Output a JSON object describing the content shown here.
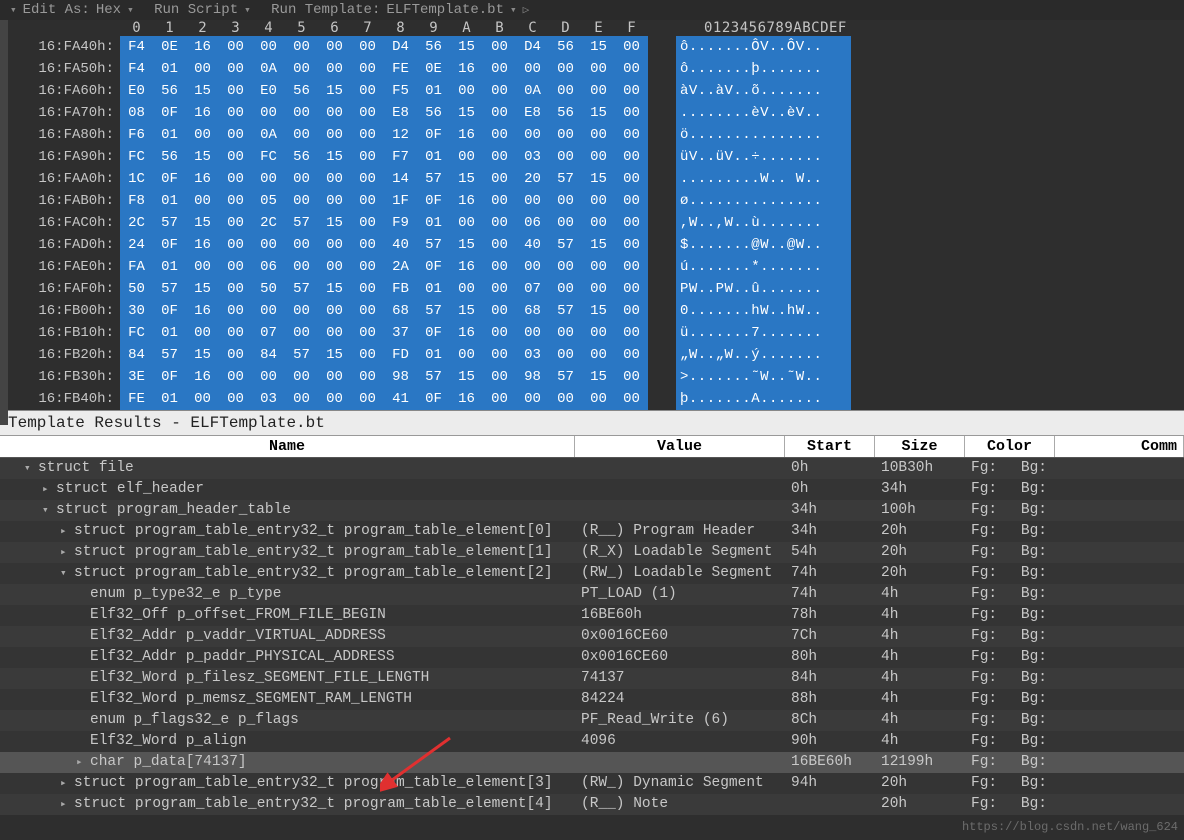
{
  "toolbar": {
    "editAs": "Edit As:",
    "editMode": "Hex",
    "runScript": "Run Script",
    "runTemplate": "Run Template:",
    "templateName": "ELFTemplate.bt"
  },
  "hexHeader": {
    "cols": [
      "0",
      "1",
      "2",
      "3",
      "4",
      "5",
      "6",
      "7",
      "8",
      "9",
      "A",
      "B",
      "C",
      "D",
      "E",
      "F"
    ],
    "ascii": "0123456789ABCDEF"
  },
  "rows": [
    {
      "addr": "16:FA40h:",
      "bytes": [
        "F4",
        "0E",
        "16",
        "00",
        "00",
        "00",
        "00",
        "00",
        "D4",
        "56",
        "15",
        "00",
        "D4",
        "56",
        "15",
        "00"
      ],
      "ascii": "ô.......ÔV..ÔV.."
    },
    {
      "addr": "16:FA50h:",
      "bytes": [
        "F4",
        "01",
        "00",
        "00",
        "0A",
        "00",
        "00",
        "00",
        "FE",
        "0E",
        "16",
        "00",
        "00",
        "00",
        "00",
        "00"
      ],
      "ascii": "ô.......þ......."
    },
    {
      "addr": "16:FA60h:",
      "bytes": [
        "E0",
        "56",
        "15",
        "00",
        "E0",
        "56",
        "15",
        "00",
        "F5",
        "01",
        "00",
        "00",
        "0A",
        "00",
        "00",
        "00"
      ],
      "ascii": "àV..àV..õ......."
    },
    {
      "addr": "16:FA70h:",
      "bytes": [
        "08",
        "0F",
        "16",
        "00",
        "00",
        "00",
        "00",
        "00",
        "E8",
        "56",
        "15",
        "00",
        "E8",
        "56",
        "15",
        "00"
      ],
      "ascii": "........èV..èV.."
    },
    {
      "addr": "16:FA80h:",
      "bytes": [
        "F6",
        "01",
        "00",
        "00",
        "0A",
        "00",
        "00",
        "00",
        "12",
        "0F",
        "16",
        "00",
        "00",
        "00",
        "00",
        "00"
      ],
      "ascii": "ö..............."
    },
    {
      "addr": "16:FA90h:",
      "bytes": [
        "FC",
        "56",
        "15",
        "00",
        "FC",
        "56",
        "15",
        "00",
        "F7",
        "01",
        "00",
        "00",
        "03",
        "00",
        "00",
        "00"
      ],
      "ascii": "üV..üV..÷......."
    },
    {
      "addr": "16:FAA0h:",
      "bytes": [
        "1C",
        "0F",
        "16",
        "00",
        "00",
        "00",
        "00",
        "00",
        "14",
        "57",
        "15",
        "00",
        "20",
        "57",
        "15",
        "00"
      ],
      "ascii": ".........W.. W.."
    },
    {
      "addr": "16:FAB0h:",
      "bytes": [
        "F8",
        "01",
        "00",
        "00",
        "05",
        "00",
        "00",
        "00",
        "1F",
        "0F",
        "16",
        "00",
        "00",
        "00",
        "00",
        "00"
      ],
      "ascii": "ø..............."
    },
    {
      "addr": "16:FAC0h:",
      "bytes": [
        "2C",
        "57",
        "15",
        "00",
        "2C",
        "57",
        "15",
        "00",
        "F9",
        "01",
        "00",
        "00",
        "06",
        "00",
        "00",
        "00"
      ],
      "ascii": ",W..,W..ù......."
    },
    {
      "addr": "16:FAD0h:",
      "bytes": [
        "24",
        "0F",
        "16",
        "00",
        "00",
        "00",
        "00",
        "00",
        "40",
        "57",
        "15",
        "00",
        "40",
        "57",
        "15",
        "00"
      ],
      "ascii": "$.......@W..@W.."
    },
    {
      "addr": "16:FAE0h:",
      "bytes": [
        "FA",
        "01",
        "00",
        "00",
        "06",
        "00",
        "00",
        "00",
        "2A",
        "0F",
        "16",
        "00",
        "00",
        "00",
        "00",
        "00"
      ],
      "ascii": "ú.......*......."
    },
    {
      "addr": "16:FAF0h:",
      "bytes": [
        "50",
        "57",
        "15",
        "00",
        "50",
        "57",
        "15",
        "00",
        "FB",
        "01",
        "00",
        "00",
        "07",
        "00",
        "00",
        "00"
      ],
      "ascii": "PW..PW..û......."
    },
    {
      "addr": "16:FB00h:",
      "bytes": [
        "30",
        "0F",
        "16",
        "00",
        "00",
        "00",
        "00",
        "00",
        "68",
        "57",
        "15",
        "00",
        "68",
        "57",
        "15",
        "00"
      ],
      "ascii": "0.......hW..hW.."
    },
    {
      "addr": "16:FB10h:",
      "bytes": [
        "FC",
        "01",
        "00",
        "00",
        "07",
        "00",
        "00",
        "00",
        "37",
        "0F",
        "16",
        "00",
        "00",
        "00",
        "00",
        "00"
      ],
      "ascii": "ü.......7......."
    },
    {
      "addr": "16:FB20h:",
      "bytes": [
        "84",
        "57",
        "15",
        "00",
        "84",
        "57",
        "15",
        "00",
        "FD",
        "01",
        "00",
        "00",
        "03",
        "00",
        "00",
        "00"
      ],
      "ascii": "„W..„W..ý......."
    },
    {
      "addr": "16:FB30h:",
      "bytes": [
        "3E",
        "0F",
        "16",
        "00",
        "00",
        "00",
        "00",
        "00",
        "98",
        "57",
        "15",
        "00",
        "98",
        "57",
        "15",
        "00"
      ],
      "ascii": ">.......˜W..˜W.."
    },
    {
      "addr": "16:FB40h:",
      "bytes": [
        "FE",
        "01",
        "00",
        "00",
        "03",
        "00",
        "00",
        "00",
        "41",
        "0F",
        "16",
        "00",
        "00",
        "00",
        "00",
        "00"
      ],
      "ascii": "þ.......A......."
    }
  ],
  "template": {
    "title": "Template Results - ELFTemplate.bt",
    "headers": {
      "name": "Name",
      "value": "Value",
      "start": "Start",
      "size": "Size",
      "color": "Color",
      "comment": "Comm"
    },
    "fg": "Fg:",
    "bg": "Bg:",
    "entries": [
      {
        "ind": 1,
        "tw": "v",
        "name": "struct file",
        "value": "",
        "start": "0h",
        "size": "10B30h",
        "hl": false
      },
      {
        "ind": 2,
        "tw": ">",
        "name": "struct elf_header",
        "value": "",
        "start": "0h",
        "size": "34h",
        "hl": false
      },
      {
        "ind": 2,
        "tw": "v",
        "name": "struct program_header_table",
        "value": "",
        "start": "34h",
        "size": "100h",
        "hl": false
      },
      {
        "ind": 3,
        "tw": ">",
        "name": "struct program_table_entry32_t program_table_element[0]",
        "value": "(R__) Program Header",
        "start": "34h",
        "size": "20h",
        "hl": false
      },
      {
        "ind": 3,
        "tw": ">",
        "name": "struct program_table_entry32_t program_table_element[1]",
        "value": "(R_X) Loadable Segment",
        "start": "54h",
        "size": "20h",
        "hl": false
      },
      {
        "ind": 3,
        "tw": "v",
        "name": "struct program_table_entry32_t program_table_element[2]",
        "value": "(RW_) Loadable Segment",
        "start": "74h",
        "size": "20h",
        "hl": false
      },
      {
        "ind": 4,
        "tw": "",
        "name": "enum p_type32_e p_type",
        "value": "PT_LOAD (1)",
        "start": "74h",
        "size": "4h",
        "hl": false
      },
      {
        "ind": 4,
        "tw": "",
        "name": "Elf32_Off p_offset_FROM_FILE_BEGIN",
        "value": "16BE60h",
        "start": "78h",
        "size": "4h",
        "hl": false
      },
      {
        "ind": 4,
        "tw": "",
        "name": "Elf32_Addr p_vaddr_VIRTUAL_ADDRESS",
        "value": "0x0016CE60",
        "start": "7Ch",
        "size": "4h",
        "hl": false
      },
      {
        "ind": 4,
        "tw": "",
        "name": "Elf32_Addr p_paddr_PHYSICAL_ADDRESS",
        "value": "0x0016CE60",
        "start": "80h",
        "size": "4h",
        "hl": false
      },
      {
        "ind": 4,
        "tw": "",
        "name": "Elf32_Word p_filesz_SEGMENT_FILE_LENGTH",
        "value": "74137",
        "start": "84h",
        "size": "4h",
        "hl": false
      },
      {
        "ind": 4,
        "tw": "",
        "name": "Elf32_Word p_memsz_SEGMENT_RAM_LENGTH",
        "value": "84224",
        "start": "88h",
        "size": "4h",
        "hl": false
      },
      {
        "ind": 4,
        "tw": "",
        "name": "enum p_flags32_e p_flags",
        "value": "PF_Read_Write (6)",
        "start": "8Ch",
        "size": "4h",
        "hl": false
      },
      {
        "ind": 4,
        "tw": "",
        "name": "Elf32_Word p_align",
        "value": "4096",
        "start": "90h",
        "size": "4h",
        "hl": false
      },
      {
        "ind": 4,
        "tw": ">",
        "name": "char p_data[74137]",
        "value": "",
        "start": "16BE60h",
        "size": "12199h",
        "hl": true
      },
      {
        "ind": 3,
        "tw": ">",
        "name": "struct program_table_entry32_t program_table_element[3]",
        "value": "(RW_) Dynamic Segment",
        "start": "94h",
        "size": "20h",
        "hl": false
      },
      {
        "ind": 3,
        "tw": ">",
        "name": "struct program_table_entry32_t program_table_element[4]",
        "value": "(R__) Note",
        "start": "",
        "size": "20h",
        "hl": false
      }
    ]
  },
  "watermark": "https://blog.csdn.net/wang_624"
}
